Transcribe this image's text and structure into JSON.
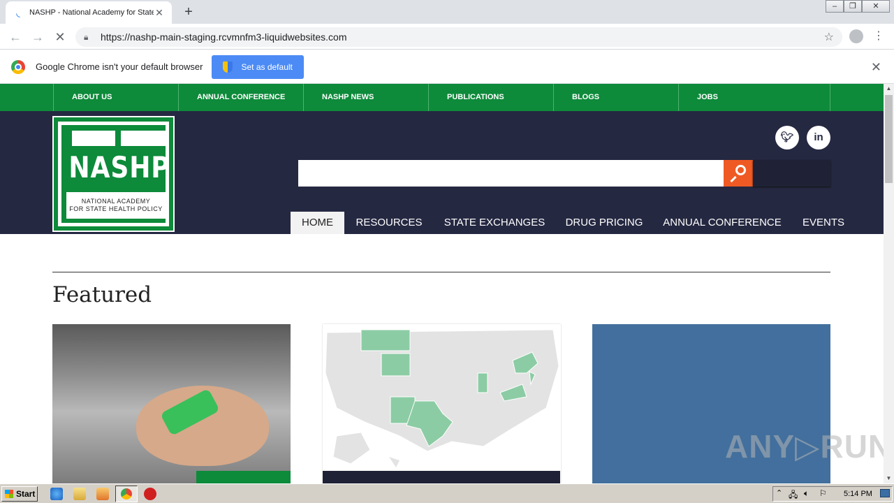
{
  "browser": {
    "tab_title": "NASHP - National Academy for State Health Policy",
    "url": "https://nashp-main-staging.rcvmnfm3-liquidwebsites.com",
    "infobar_message": "Google Chrome isn't your default browser",
    "infobar_button": "Set as default"
  },
  "site": {
    "top_nav": [
      "ABOUT US",
      "ANNUAL CONFERENCE",
      "NASHP NEWS",
      "PUBLICATIONS",
      "BLOGS",
      "JOBS"
    ],
    "logo_word": "NASHP",
    "logo_tagline_1": "NATIONAL ACADEMY",
    "logo_tagline_2": "FOR STATE HEALTH POLICY",
    "social": {
      "twitter": "twitter-icon",
      "linkedin": "in"
    },
    "search_placeholder": "",
    "main_nav": [
      "HOME",
      "RESOURCES",
      "STATE EXCHANGES",
      "DRUG PRICING",
      "ANNUAL CONFERENCE",
      "EVENTS"
    ],
    "main_nav_active": "HOME",
    "featured_heading": "Featured",
    "colors": {
      "green": "#0d8a3a",
      "navy": "#252841",
      "orange": "#ef5a24",
      "blue": "#426f9d"
    }
  },
  "watermark": "ANY▷RUN",
  "taskbar": {
    "start_label": "Start",
    "clock": "5:14 PM"
  }
}
